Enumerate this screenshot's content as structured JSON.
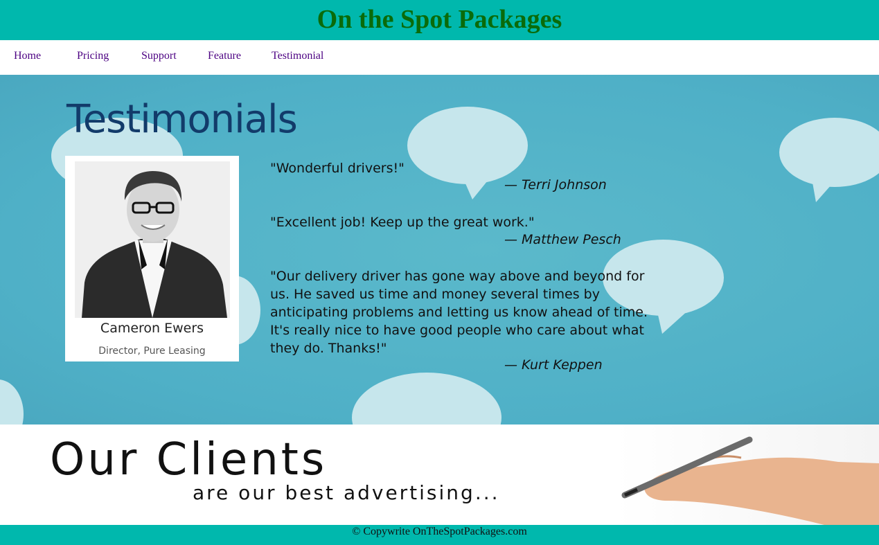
{
  "site_title": "On the Spot Packages",
  "nav": {
    "home": "Home",
    "pricing": "Pricing",
    "support": "Support",
    "feature": "Feature",
    "testimonial": "Testimonial"
  },
  "hero": {
    "title": "Testimonials",
    "card": {
      "name": "Cameron Ewers",
      "role": "Director, Pure Leasing"
    },
    "testimonials": [
      {
        "quote": "\"Wonderful drivers!\"",
        "author": "— Terri Johnson"
      },
      {
        "quote": "\"Excellent job! Keep up the great work.\"",
        "author": "— Matthew Pesch"
      },
      {
        "quote": "\"Our delivery driver has gone way above and beyond for us. He saved us time and money several times by anticipating problems and letting us know ahead of time. It's really nice to have good people who care about what they do. Thanks!\"",
        "author": "— Kurt Keppen"
      }
    ]
  },
  "clients": {
    "title": "Our Clients",
    "subtitle": "are our best advertising..."
  },
  "footer": {
    "copyright": "© Copywrite OnTheSpotPackages.com"
  },
  "colors": {
    "header_bg": "#00b8ad",
    "title": "#0a6b0a",
    "nav_link": "#4b0082",
    "hero_bg": "#4fb0c7"
  }
}
